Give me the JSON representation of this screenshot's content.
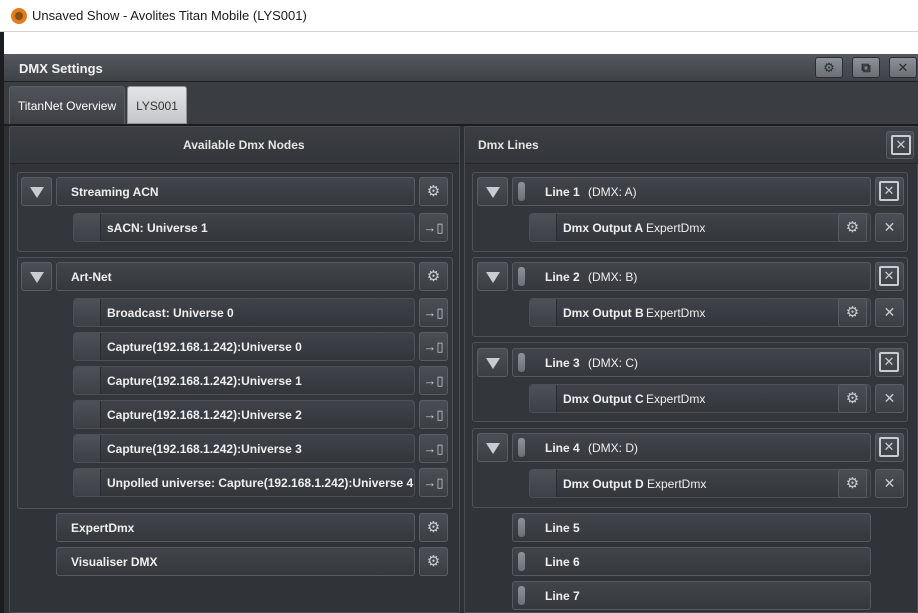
{
  "window": {
    "title": "Unsaved Show - Avolites Titan Mobile (LYS001)"
  },
  "dialog": {
    "title": "DMX Settings",
    "header_buttons": {
      "settings": "⚙",
      "restore": "⧉",
      "close": "✕"
    }
  },
  "tabs": [
    {
      "label": "TitanNet Overview"
    },
    {
      "label": "LYS001"
    }
  ],
  "nodes_panel": {
    "title": "Available Dmx Nodes",
    "groups": [
      {
        "label": "Streaming ACN",
        "items": [
          "sACN: Universe 1"
        ]
      },
      {
        "label": "Art-Net",
        "items": [
          "Broadcast: Universe 0",
          "Capture(192.168.1.242):Universe 0",
          "Capture(192.168.1.242):Universe 1",
          "Capture(192.168.1.242):Universe 2",
          "Capture(192.168.1.242):Universe 3",
          "Unpolled universe: Capture(192.168.1.242):Universe 4"
        ]
      }
    ],
    "standalone": [
      "ExpertDmx",
      "Visualiser DMX"
    ]
  },
  "lines_panel": {
    "title": "Dmx Lines",
    "lines": [
      {
        "name": "Line 1",
        "dmx": "(DMX: A)",
        "output": "Dmx Output A",
        "device": "ExpertDmx"
      },
      {
        "name": "Line 2",
        "dmx": "(DMX: B)",
        "output": "Dmx Output B",
        "device": "ExpertDmx"
      },
      {
        "name": "Line 3",
        "dmx": "(DMX: C)",
        "output": "Dmx Output C",
        "device": "ExpertDmx"
      },
      {
        "name": "Line 4",
        "dmx": "(DMX: D)",
        "output": "Dmx Output D",
        "device": "ExpertDmx"
      }
    ],
    "empty_lines": [
      "Line 5",
      "Line 6",
      "Line 7"
    ]
  },
  "icons": {
    "expand": "triangle-down-icon",
    "settings": "gear-icon",
    "patch": "patch-arrow-icon",
    "remove": "close-icon",
    "clear": "clear-box-icon",
    "app": "avolites-logo-icon"
  },
  "colors": {
    "app_icon": "#e07c1c",
    "background": "#2b2e33",
    "panel": "#303338",
    "text": "#efefef"
  }
}
